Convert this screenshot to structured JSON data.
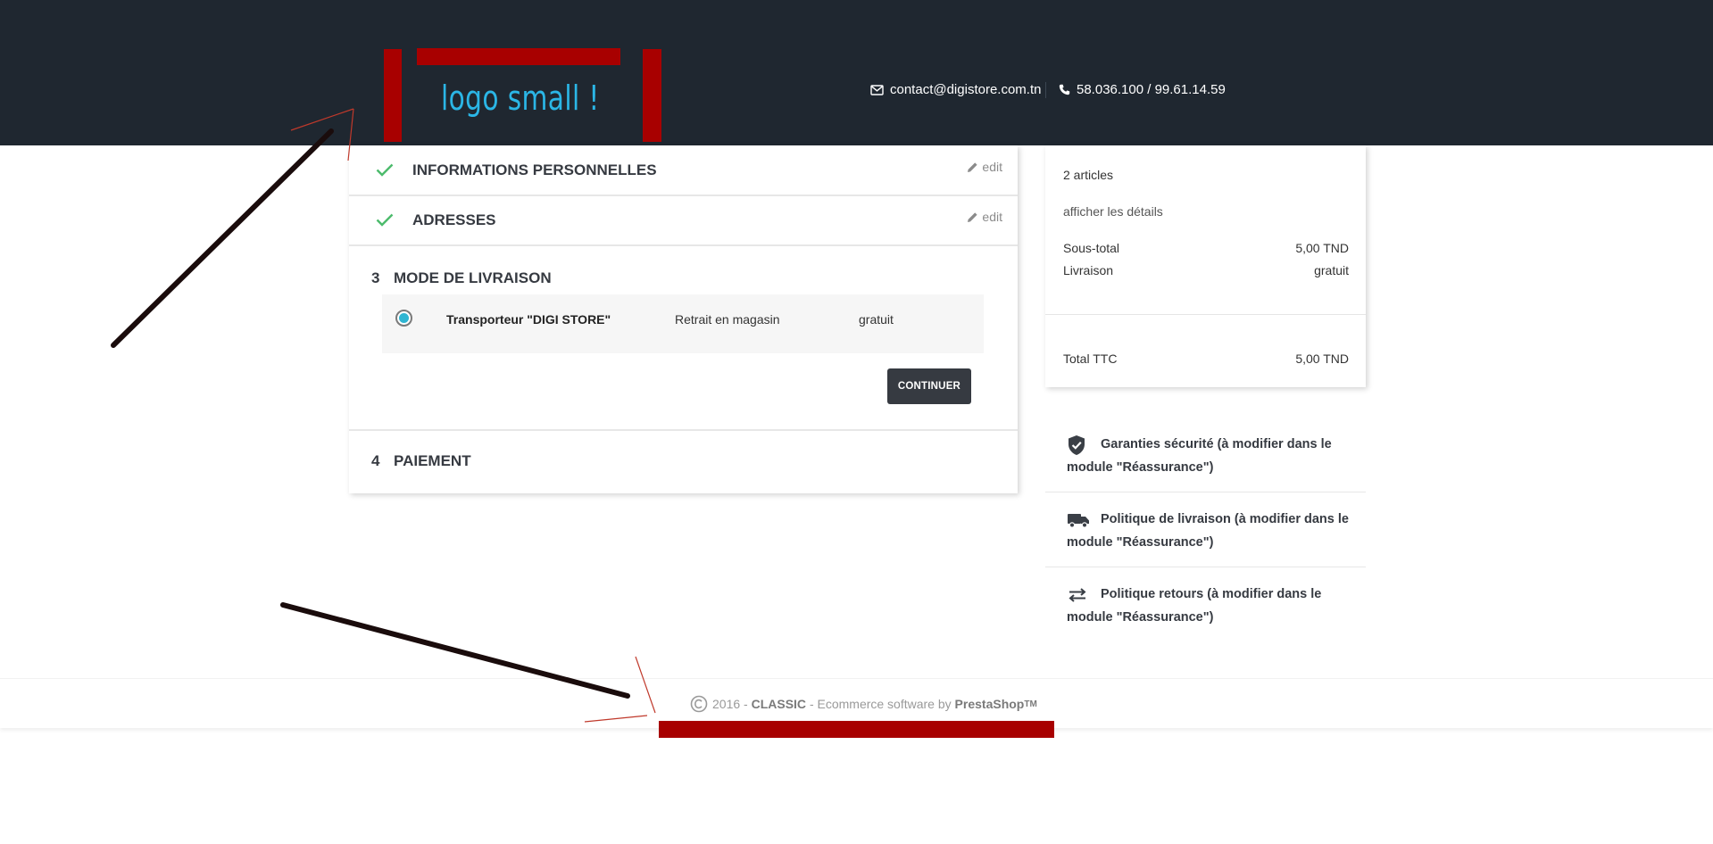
{
  "header": {
    "logo_text": "logo small !",
    "email": "contact@digistore.com.tn",
    "phone": "58.036.100 / 99.61.14.59"
  },
  "checkout": {
    "steps": [
      {
        "title": "INFORMATIONS PERSONNELLES",
        "edit_label": "edit",
        "status": "complete"
      },
      {
        "title": "ADRESSES",
        "edit_label": "edit",
        "status": "complete"
      },
      {
        "number": "3",
        "title": "MODE DE LIVRAISON",
        "status": "current"
      },
      {
        "number": "4",
        "title": "PAIEMENT",
        "status": "pending"
      }
    ],
    "carrier": {
      "name": "Transporteur \"DIGI STORE\"",
      "delay": "Retrait en magasin",
      "price": "gratuit",
      "selected": true
    },
    "continue_label": "CONTINUER"
  },
  "summary": {
    "items_count": "2 articles",
    "details_link": "afficher les détails",
    "subtotal_label": "Sous-total",
    "subtotal_value": "5,00 TND",
    "shipping_label": "Livraison",
    "shipping_value": "gratuit",
    "total_label": "Total TTC",
    "total_value": "5,00 TND"
  },
  "reassurance": [
    {
      "icon": "shield-check-icon",
      "text": "Garanties sécurité (à modifier dans le module \"Réassurance\")"
    },
    {
      "icon": "truck-icon",
      "text": "Politique de livraison (à modifier dans le module \"Réassurance\")"
    },
    {
      "icon": "exchange-arrows-icon",
      "text": "Politique retours (à modifier dans le module \"Réassurance\")"
    }
  ],
  "footer": {
    "copyright_year": "2016 -",
    "theme_name": "CLASSIC",
    "middle_text": "- Ecommerce software by",
    "vendor": "PrestaShop",
    "trademark": "TM"
  },
  "colors": {
    "header_bg": "#1f2730",
    "logo_text": "#2bb6e6",
    "accent": "#2fb5d2",
    "success_check": "#4cbb6c",
    "button_bg": "#363a41",
    "annotation_red": "#a80000"
  }
}
